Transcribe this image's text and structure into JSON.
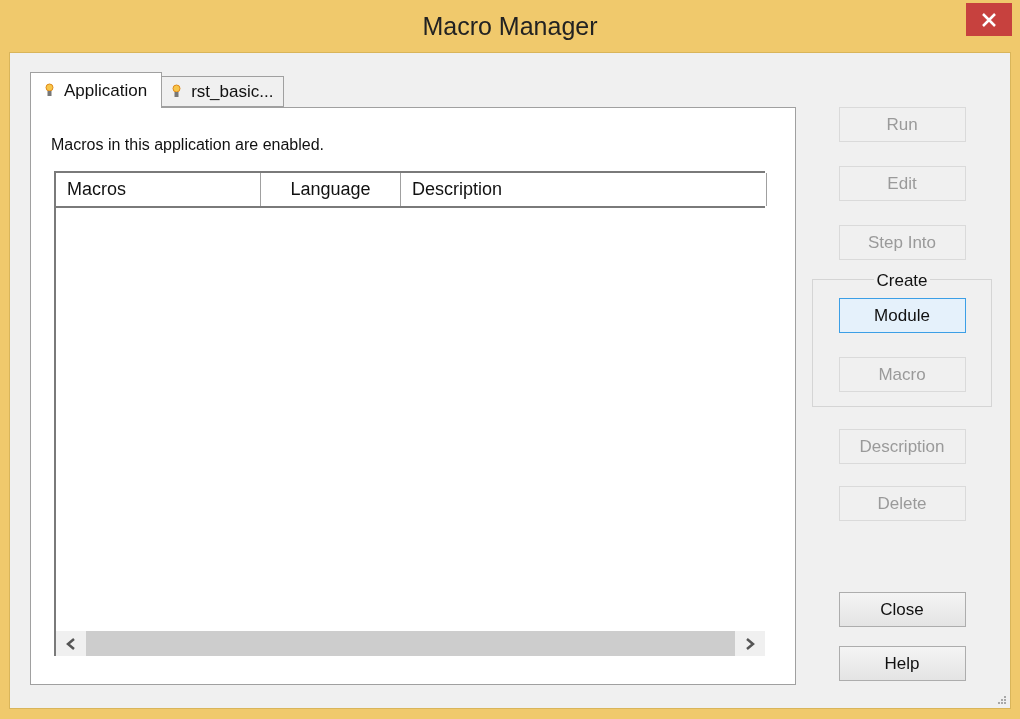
{
  "window": {
    "title": "Macro Manager"
  },
  "tabs": [
    {
      "label": "Application",
      "selected": true
    },
    {
      "label": "rst_basic...",
      "selected": false
    }
  ],
  "message": "Macros in this application are enabled.",
  "table": {
    "columns": [
      "Macros",
      "Language",
      "Description"
    ]
  },
  "buttons_top": [
    {
      "label": "Run",
      "disabled": true,
      "focused": false
    },
    {
      "label": "Edit",
      "disabled": true,
      "focused": false
    },
    {
      "label": "Step Into",
      "disabled": true,
      "focused": false
    }
  ],
  "create_group": {
    "label": "Create",
    "buttons": [
      {
        "label": "Module",
        "disabled": false,
        "focused": true
      },
      {
        "label": "Macro",
        "disabled": true,
        "focused": false
      }
    ]
  },
  "buttons_middle": [
    {
      "label": "Description",
      "disabled": true,
      "focused": false
    },
    {
      "label": "Delete",
      "disabled": true,
      "focused": false
    }
  ],
  "buttons_bottom": [
    {
      "label": "Close",
      "disabled": false,
      "focused": false
    },
    {
      "label": "Help",
      "disabled": false,
      "focused": false
    }
  ]
}
